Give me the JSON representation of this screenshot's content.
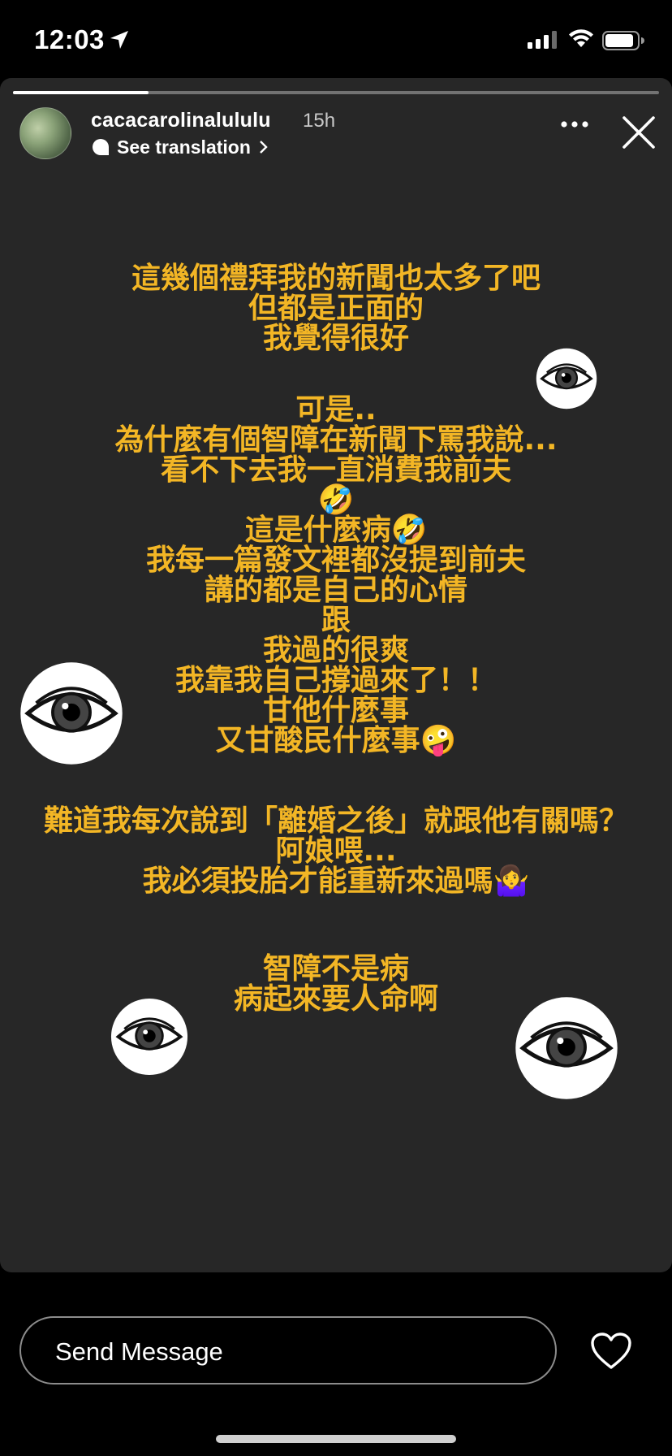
{
  "status_bar": {
    "time": "12:03",
    "icons": [
      "location-arrow-icon",
      "signal-icon",
      "wifi-icon",
      "battery-icon"
    ]
  },
  "story": {
    "progress": 0.21,
    "username": "cacacarolinalululu",
    "time_ago": "15h",
    "translation_label": "See translation",
    "text_color": "#f3b625",
    "background": "#272727",
    "paragraphs": [
      "這幾個禮拜我的新聞也太多了吧\n但都是正面的\n我覺得很好",
      "可是..\n為什麼有個智障在新聞下罵我說...\n看不下去我一直消費我前夫\n🤣\n這是什麼病🤣\n我每一篇發文裡都沒提到前夫\n講的都是自己的心情\n跟\n我過的很爽\n我靠我自己撐過來了！！\n甘他什麼事\n又甘酸民什麼事🤪",
      "難道我每次說到「離婚之後」就跟他有關嗎？\n阿娘喂...\n我必須投胎才能重新來過嗎🤷‍♀️",
      "智障不是病\n病起來要人命啊"
    ]
  },
  "message_bar": {
    "placeholder": "Send Message",
    "icons": [
      "heart-icon"
    ]
  }
}
